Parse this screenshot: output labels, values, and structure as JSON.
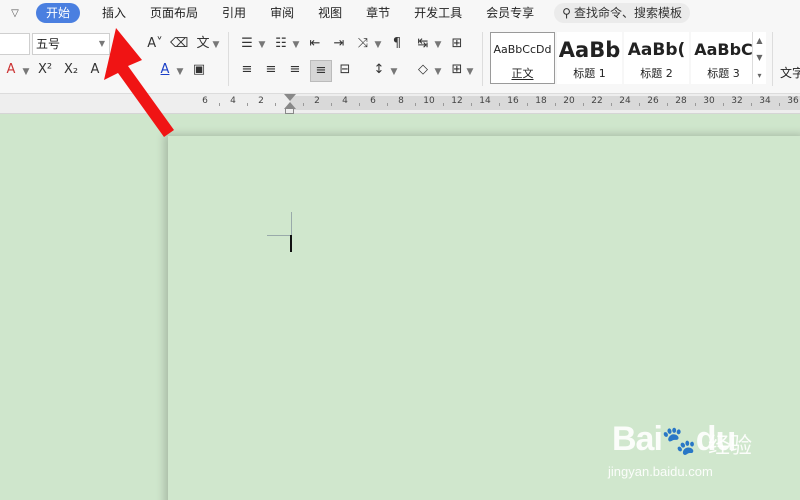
{
  "menu": {
    "tabs": [
      "开始",
      "插入",
      "页面布局",
      "引用",
      "审阅",
      "视图",
      "章节",
      "开发工具",
      "会员专享"
    ],
    "search_label": "查找命令、搜索模板"
  },
  "ribbon": {
    "font_size": "五号",
    "styles": [
      {
        "preview": "AaBbCcDd",
        "name": "正文"
      },
      {
        "preview": "AaBb",
        "name": "标题 1"
      },
      {
        "preview": "AaBb(",
        "name": "标题 2"
      },
      {
        "preview": "AaBbC",
        "name": "标题 3"
      }
    ],
    "text_group": "文字"
  },
  "ruler": {
    "left_labels": [
      "6",
      "4",
      "2"
    ],
    "right_labels": [
      "2",
      "4",
      "6",
      "8",
      "10",
      "12",
      "14",
      "16",
      "18",
      "20",
      "22",
      "24",
      "26",
      "28",
      "30",
      "32",
      "34",
      "36"
    ]
  },
  "watermark": {
    "brand": "Bai",
    "brand2": "du",
    "cn": "经验",
    "url": "jingyan.baidu.com"
  },
  "colors": {
    "accent": "#4a7fe0",
    "document_bg": "#d0e7cd",
    "arrow": "#f01414"
  }
}
